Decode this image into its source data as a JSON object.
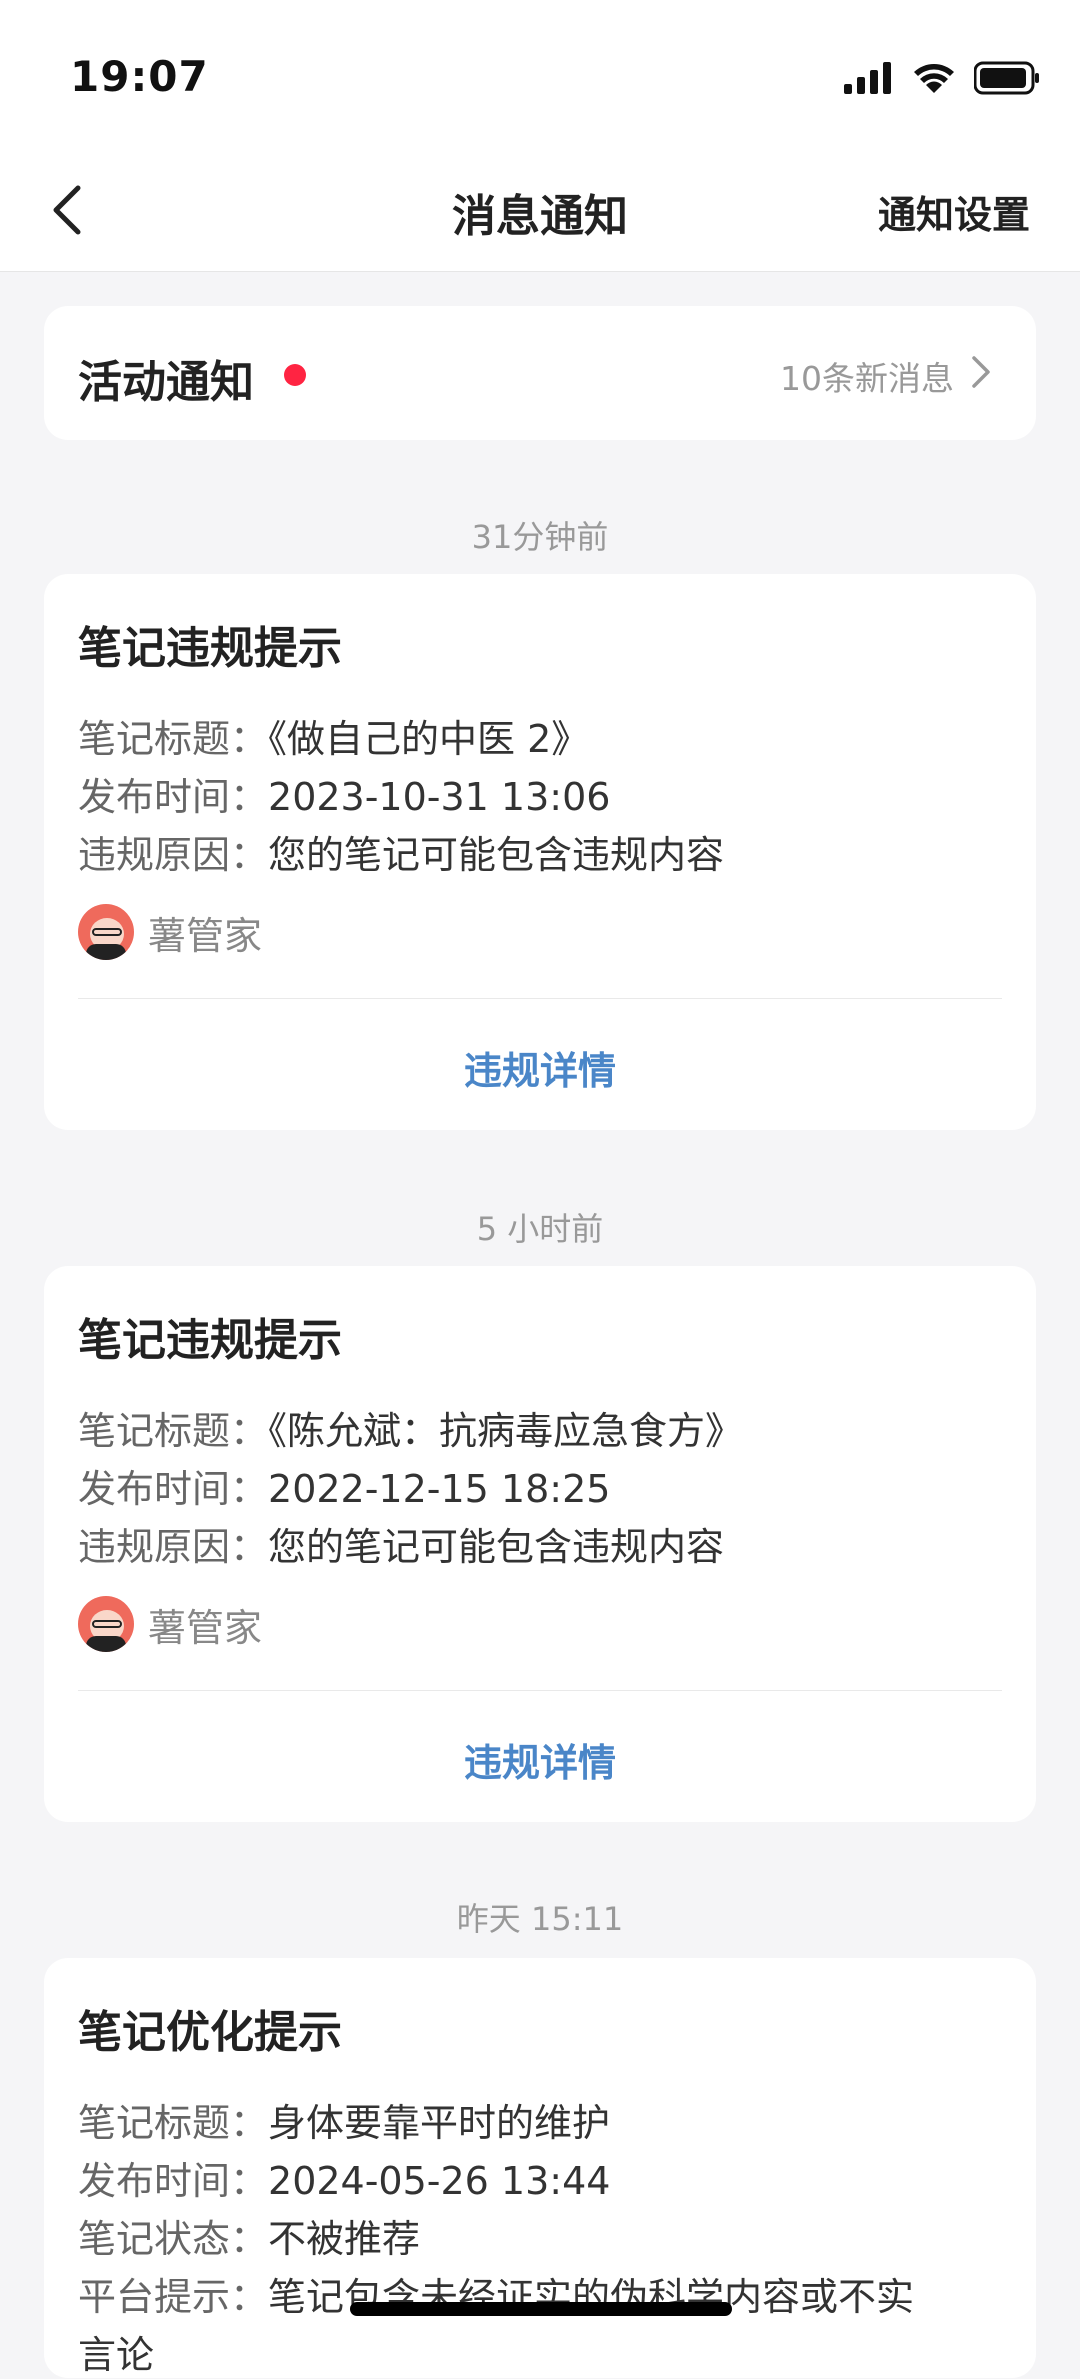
{
  "status_bar": {
    "time": "19:07"
  },
  "nav": {
    "title": "消息通知",
    "settings_label": "通知设置"
  },
  "activity": {
    "title": "活动通知",
    "count_text": "10条新消息"
  },
  "notifications": [
    {
      "timestamp": "31分钟前",
      "title": "笔记违规提示",
      "fields": [
        {
          "label": "笔记标题：",
          "value": "《做自己的中医 2》"
        },
        {
          "label": "发布时间：",
          "value": "2023-10-31 13:06"
        },
        {
          "label": "违规原因：",
          "value": "您的笔记可能包含违规内容"
        }
      ],
      "sender": "薯管家",
      "action": "违规详情"
    },
    {
      "timestamp": "5 小时前",
      "title": "笔记违规提示",
      "fields": [
        {
          "label": "笔记标题：",
          "value": "《陈允斌：抗病毒应急食方》"
        },
        {
          "label": "发布时间：",
          "value": "2022-12-15 18:25"
        },
        {
          "label": "违规原因：",
          "value": "您的笔记可能包含违规内容"
        }
      ],
      "sender": "薯管家",
      "action": "违规详情"
    },
    {
      "timestamp": "昨天 15:11",
      "title": "笔记优化提示",
      "fields": [
        {
          "label": "笔记标题：",
          "value": "身体要靠平时的维护"
        },
        {
          "label": "发布时间：",
          "value": "2024-05-26 13:44"
        },
        {
          "label": "笔记状态：",
          "value": "不被推荐"
        },
        {
          "label": "平台提示：",
          "value": "笔记包含未经证实的伪科学内容或不实"
        },
        {
          "label": "",
          "value": "言论"
        }
      ]
    }
  ],
  "colors": {
    "accent_red": "#ff2442",
    "link_blue": "#4a86c8",
    "background": "#f5f5f7"
  },
  "icons": [
    "signal-icon",
    "wifi-icon",
    "battery-icon",
    "back-arrow-icon",
    "chevron-right-icon",
    "avatar-icon"
  ]
}
